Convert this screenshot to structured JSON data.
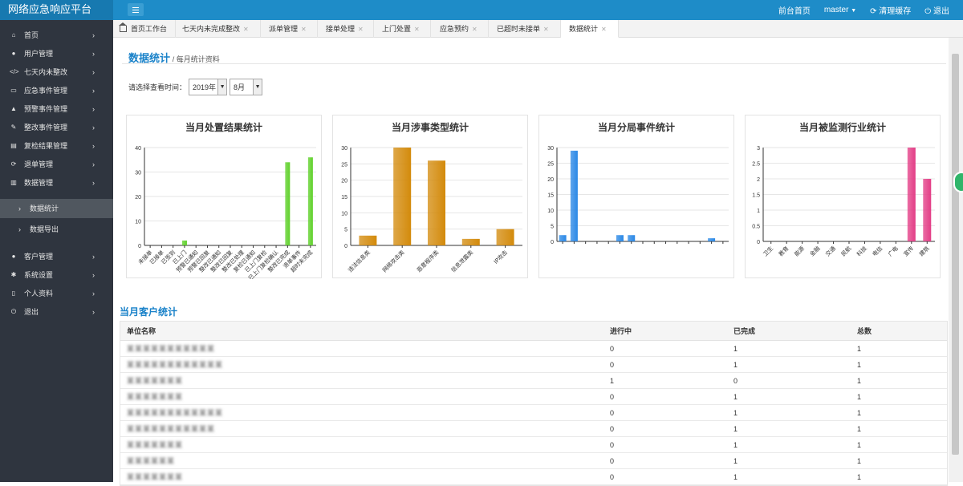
{
  "app": {
    "title": "网络应急响应平台"
  },
  "topnav": {
    "front_page": "前台首页",
    "user": "master",
    "clear_cache": "清理缓存",
    "logout": "退出"
  },
  "sidebar": {
    "items": [
      {
        "label": "首页",
        "icon": "home-icon"
      },
      {
        "label": "用户管理",
        "icon": "user-icon"
      },
      {
        "label": "七天内未整改",
        "icon": "code-icon"
      },
      {
        "label": "应急事件管理",
        "icon": "keyboard-icon"
      },
      {
        "label": "预警事件管理",
        "icon": "warning-icon"
      },
      {
        "label": "整改事件管理",
        "icon": "wrench-icon"
      },
      {
        "label": "复检结果管理",
        "icon": "list-icon"
      },
      {
        "label": "退单管理",
        "icon": "refresh-icon"
      },
      {
        "label": "数据管理",
        "icon": "chart-icon"
      },
      {
        "label": "客户管理",
        "icon": "user-icon"
      },
      {
        "label": "系统设置",
        "icon": "gear-icon"
      },
      {
        "label": "个人资料",
        "icon": "document-icon"
      },
      {
        "label": "退出",
        "icon": "power-icon"
      }
    ],
    "sub_items": [
      {
        "label": "数据统计"
      },
      {
        "label": "数据导出"
      }
    ]
  },
  "tabs": [
    {
      "label": "首页工作台"
    },
    {
      "label": "七天内未完成整改"
    },
    {
      "label": "派单管理"
    },
    {
      "label": "接单处理"
    },
    {
      "label": "上门处置"
    },
    {
      "label": "应急预约"
    },
    {
      "label": "已超时未接单"
    },
    {
      "label": "数据统计"
    }
  ],
  "page": {
    "title": "数据统计",
    "subtitle": "/ 每月统计资料"
  },
  "filter": {
    "label": "请选择查看时间：",
    "year": "2019年",
    "month": "8月"
  },
  "chart_data": [
    {
      "type": "bar",
      "title": "当月处置结果统计",
      "categories": [
        "未接单",
        "已接单",
        "已签到",
        "已上门",
        "预警已通知",
        "预警已回复",
        "整改已通知",
        "整改已回复",
        "整改已处理",
        "复检已通知",
        "已上门复检",
        "已上门复检确认",
        "整改已完成",
        "退单事件",
        "超时未完成"
      ],
      "values": [
        0,
        0,
        0,
        2,
        0,
        0,
        0,
        0,
        0,
        0,
        0,
        0,
        34,
        0,
        36
      ],
      "ylim": [
        0,
        40
      ],
      "yticks": [
        0,
        10,
        20,
        30,
        40
      ],
      "color": "#5fd12a"
    },
    {
      "type": "bar",
      "title": "当月涉事类型统计",
      "categories": [
        "违法信息类",
        "网络攻击类",
        "恶意程序类",
        "信息泄露类",
        "IP攻击"
      ],
      "values": [
        3,
        30,
        26,
        2,
        5
      ],
      "ylim": [
        0,
        30
      ],
      "yticks": [
        0,
        5,
        10,
        15,
        20,
        25,
        30
      ],
      "color": "#d38a0b"
    },
    {
      "type": "bar",
      "title": "当月分局事件统计",
      "categories": [
        "",
        "",
        "",
        "",
        "",
        "",
        "",
        "",
        "",
        "",
        "",
        "",
        "",
        "",
        ""
      ],
      "values": [
        2,
        29,
        0,
        0,
        0,
        2,
        2,
        0,
        0,
        0,
        0,
        0,
        0,
        1,
        0
      ],
      "ylim": [
        0,
        30
      ],
      "yticks": [
        0,
        5,
        10,
        15,
        20,
        25,
        30
      ],
      "color": "#2a88e6"
    },
    {
      "type": "bar",
      "title": "当月被监测行业统计",
      "categories": [
        "卫生",
        "教育",
        "能源",
        "金融",
        "交通",
        "民航",
        "科技",
        "电信",
        "广电",
        "宣传",
        "建筑"
      ],
      "values": [
        0,
        0,
        0,
        0,
        0,
        0,
        0,
        0,
        0,
        3,
        2
      ],
      "ylim": [
        0,
        3
      ],
      "yticks": [
        0,
        0.5,
        1,
        1.5,
        2,
        2.5,
        3
      ],
      "color": "#e33d86"
    }
  ],
  "customers": {
    "title": "当月客户统计",
    "columns": [
      "单位名称",
      "进行中",
      "已完成",
      "总数"
    ],
    "rows": [
      {
        "name": "某某某某某某某某某某某",
        "ongoing": "0",
        "done": "1",
        "total": "1"
      },
      {
        "name": "某某某某某某某某某某某某",
        "ongoing": "0",
        "done": "1",
        "total": "1"
      },
      {
        "name": "某某某某某某某",
        "ongoing": "1",
        "done": "0",
        "total": "1"
      },
      {
        "name": "某某某某某某某",
        "ongoing": "0",
        "done": "1",
        "total": "1"
      },
      {
        "name": "某某某某某某某某某某某某",
        "ongoing": "0",
        "done": "1",
        "total": "1"
      },
      {
        "name": "某某某某某某某某某某某",
        "ongoing": "0",
        "done": "1",
        "total": "1"
      },
      {
        "name": "某某某某某某某",
        "ongoing": "0",
        "done": "1",
        "total": "1"
      },
      {
        "name": "某某某某某某",
        "ongoing": "0",
        "done": "1",
        "total": "1"
      },
      {
        "name": "某某某某某某某",
        "ongoing": "0",
        "done": "1",
        "total": "1"
      }
    ]
  }
}
